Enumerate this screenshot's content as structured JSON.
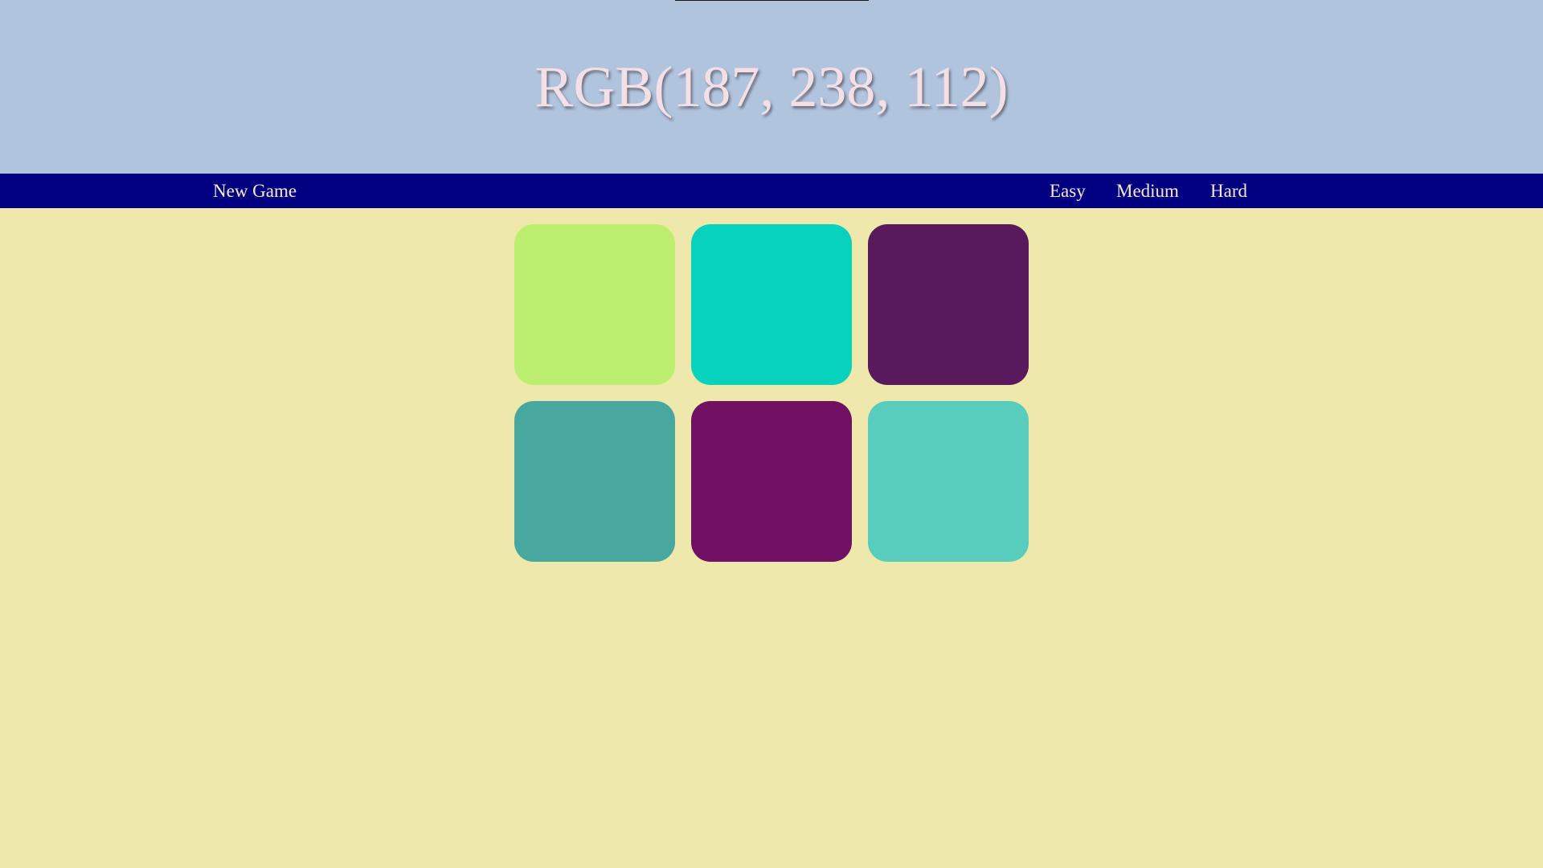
{
  "header": {
    "target_color_label": "RGB(187, 238, 112)",
    "background_color": "#b0c4de"
  },
  "navbar": {
    "new_game_label": "New Game",
    "difficulty_options": [
      "Easy",
      "Medium",
      "Hard"
    ]
  },
  "board": {
    "squares": [
      {
        "color": "#bcee70"
      },
      {
        "color": "#07d2bd"
      },
      {
        "color": "#581a5d"
      },
      {
        "color": "#48a89f"
      },
      {
        "color": "#721063"
      },
      {
        "color": "#58cdbd"
      }
    ]
  }
}
